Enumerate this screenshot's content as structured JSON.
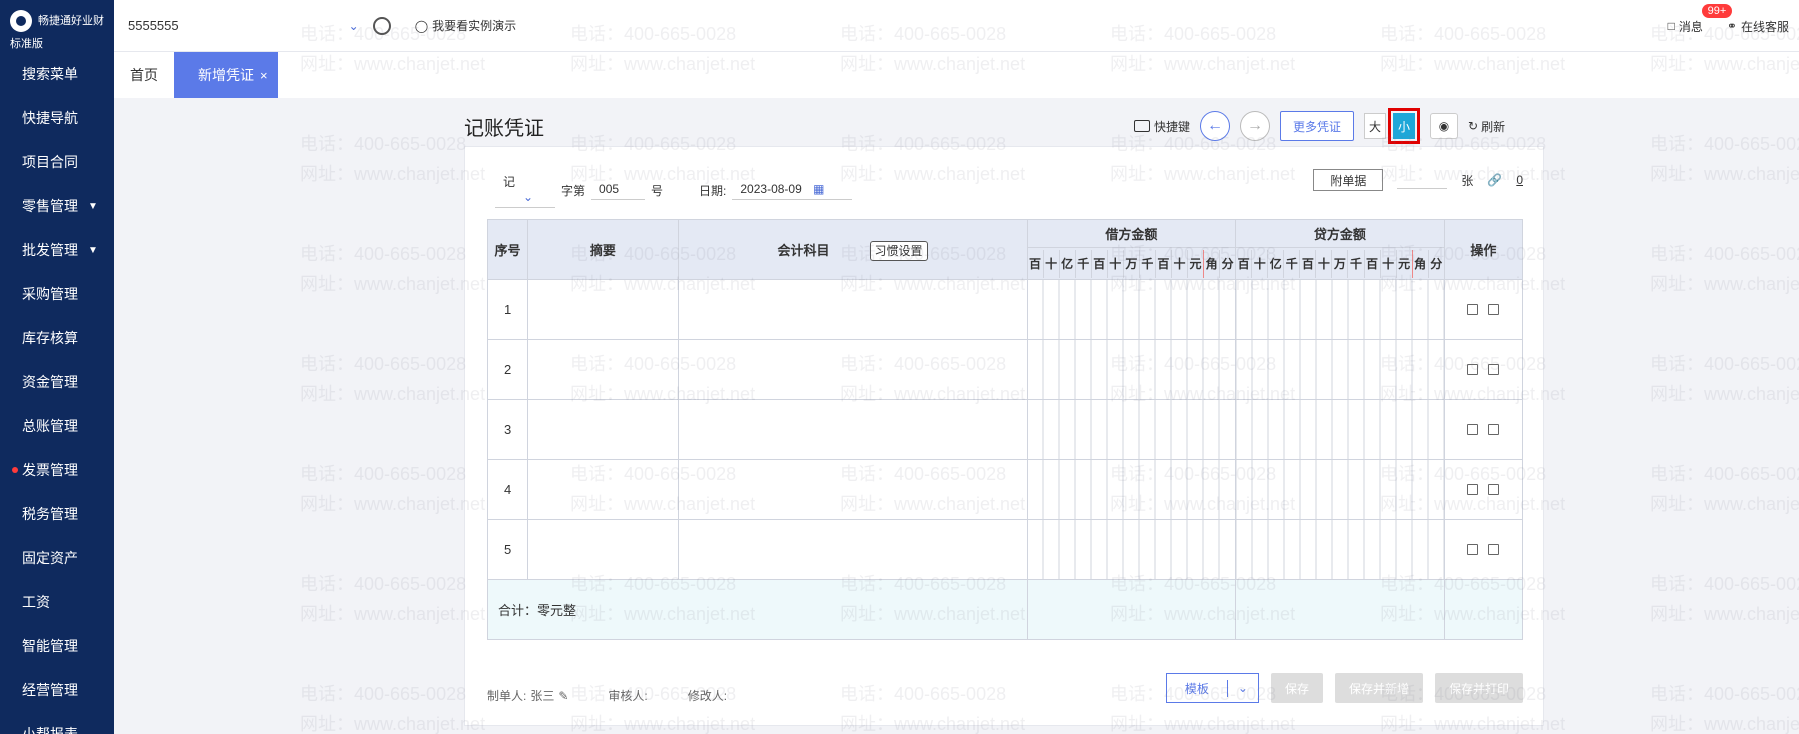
{
  "brand": {
    "name": "畅捷通好业财",
    "edition": "标准版"
  },
  "sidebar": {
    "items": [
      {
        "label": "搜索菜单",
        "caret": false,
        "dot": false
      },
      {
        "label": "快捷导航",
        "caret": false,
        "dot": false
      },
      {
        "label": "项目合同",
        "caret": false,
        "dot": false
      },
      {
        "label": "零售管理",
        "caret": true,
        "dot": false
      },
      {
        "label": "批发管理",
        "caret": true,
        "dot": false
      },
      {
        "label": "采购管理",
        "caret": false,
        "dot": false
      },
      {
        "label": "库存核算",
        "caret": false,
        "dot": false
      },
      {
        "label": "资金管理",
        "caret": false,
        "dot": false
      },
      {
        "label": "总账管理",
        "caret": false,
        "dot": false
      },
      {
        "label": "发票管理",
        "caret": false,
        "dot": true
      },
      {
        "label": "税务管理",
        "caret": false,
        "dot": false
      },
      {
        "label": "固定资产",
        "caret": false,
        "dot": false
      },
      {
        "label": "工资",
        "caret": false,
        "dot": false
      },
      {
        "label": "智能管理",
        "caret": false,
        "dot": false
      },
      {
        "label": "经营管理",
        "caret": false,
        "dot": false
      },
      {
        "label": "小帮报表",
        "caret": false,
        "dot": false
      }
    ]
  },
  "topbar": {
    "company": "5555555",
    "demo": "我要看实例演示",
    "messages": "消息",
    "badge": "99+",
    "service": "在线客服"
  },
  "tabs": [
    {
      "label": "首页"
    },
    {
      "label": "新增凭证",
      "close": "×"
    }
  ],
  "page_title": "记账凭证",
  "toolbar": {
    "shortcut": "快捷键",
    "prev": "←",
    "next": "→",
    "more": "更多凭证",
    "size_big": "大",
    "size_small": "小",
    "refresh": "刷新"
  },
  "voucher": {
    "type": "记",
    "zi_di": "字第",
    "number": "005",
    "hao": "号",
    "date_label": "日期:",
    "date": "2023-08-09",
    "attach_label": "附单据",
    "attach_unit": "张",
    "attach_count": "0"
  },
  "table": {
    "headers": {
      "seq": "序号",
      "summary": "摘要",
      "account": "会计科目",
      "habit": "习惯设置",
      "debit": "借方金额",
      "credit": "贷方金额",
      "ops": "操作"
    },
    "digits": [
      "百",
      "十",
      "亿",
      "千",
      "百",
      "十",
      "万",
      "千",
      "百",
      "十",
      "元",
      "角",
      "分"
    ],
    "rows": [
      "1",
      "2",
      "3",
      "4",
      "5"
    ],
    "total": "合计：零元整"
  },
  "footer": {
    "maker_label": "制单人:",
    "maker": "张三",
    "auditor_label": "审核人:",
    "modifier_label": "修改人:",
    "template": "模板",
    "save": "保存",
    "save_new": "保存并新增",
    "save_print": "保存并打印"
  },
  "watermark": {
    "phone": "电话：400-665-0028",
    "site": "网址：www.chanjet.net"
  }
}
